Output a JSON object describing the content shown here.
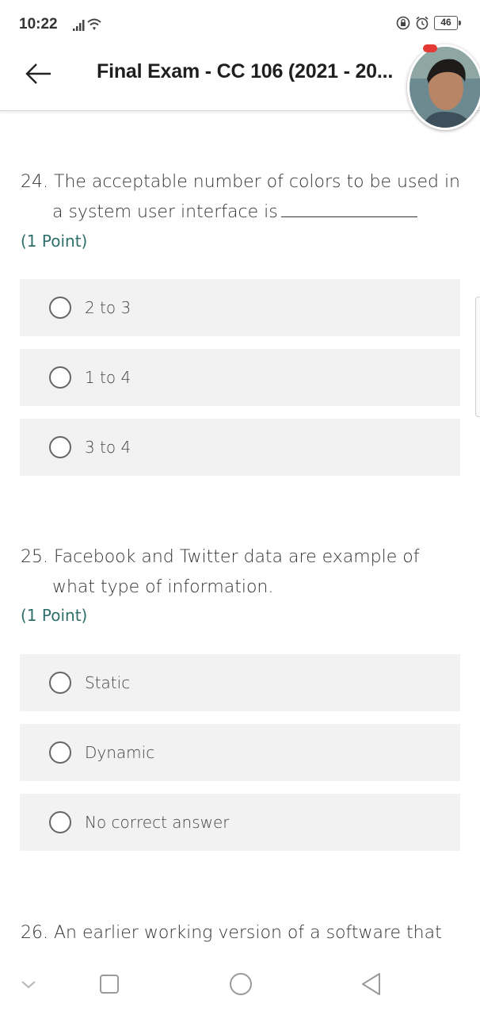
{
  "status_bar": {
    "time": "10:22",
    "battery_level": "46",
    "icons": [
      "signal-icon",
      "wifi-icon",
      "lock-rotation-icon",
      "alarm-icon",
      "battery-icon"
    ]
  },
  "header": {
    "title": "Final Exam - CC 106 (2021 - 20...",
    "back_icon": "arrow-left-icon"
  },
  "questions": [
    {
      "number": "24.",
      "text_line1": "The acceptable number of colors to be used in",
      "text_line2": "a system user interface is",
      "points": "(1 Point)",
      "options": [
        "2 to 3",
        "1 to 4",
        "3 to 4"
      ]
    },
    {
      "number": "25.",
      "text_line1": "Facebook and Twitter data are example of",
      "text_line2": "what type of information.",
      "points": "(1 Point)",
      "options": [
        "Static",
        "Dynamic",
        "No correct answer"
      ]
    },
    {
      "number": "26.",
      "text_line1": "An earlier working version of a software that"
    }
  ],
  "nav_bar": {
    "buttons": [
      "chevron-down-icon",
      "recent-apps-icon",
      "home-icon",
      "back-triangle-icon"
    ]
  },
  "colors": {
    "points_text": "#2e6f6b",
    "option_bg": "#f2f2f2"
  }
}
